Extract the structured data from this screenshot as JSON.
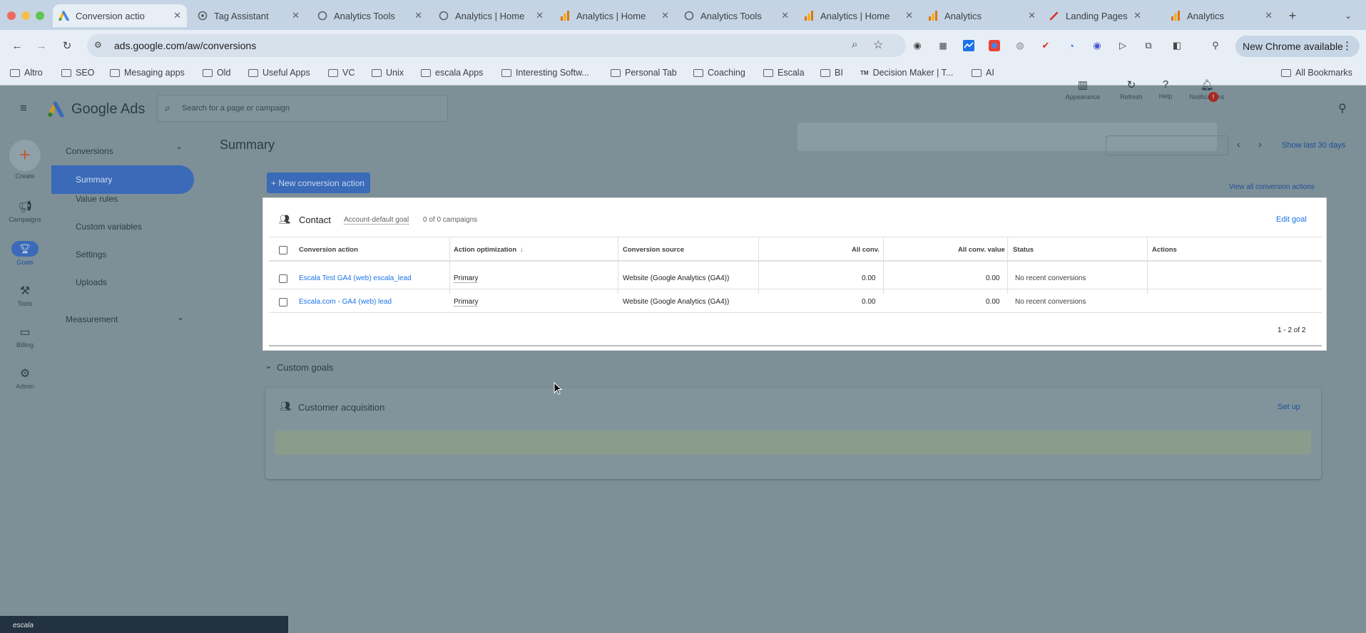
{
  "browser": {
    "tabs": [
      {
        "title": "Conversion actio",
        "icon": "google-ads-icon",
        "active": true
      },
      {
        "title": "Tag Assistant",
        "icon": "tag-assistant-icon",
        "active": false
      },
      {
        "title": "Analytics Tools",
        "icon": "google-icon",
        "active": false
      },
      {
        "title": "Analytics | Home",
        "icon": "google-icon",
        "active": false
      },
      {
        "title": "Analytics | Home",
        "icon": "analytics-icon",
        "active": false
      },
      {
        "title": "Analytics Tools",
        "icon": "google-icon",
        "active": false
      },
      {
        "title": "Analytics | Home",
        "icon": "analytics-icon",
        "active": false
      },
      {
        "title": "Analytics",
        "icon": "analytics-icon",
        "active": false
      },
      {
        "title": "Landing Pages",
        "icon": "pen-icon",
        "active": false
      },
      {
        "title": "Analytics",
        "icon": "analytics-icon",
        "active": false
      }
    ],
    "url": "ads.google.com/aw/conversions",
    "new_chrome_label": "New Chrome available",
    "bookmarks": [
      "Altro",
      "SEO",
      "Mesaging apps",
      "Old",
      "Useful Apps",
      "VC",
      "Unix",
      "escala Apps",
      "Interesting Softw...",
      "Personal Tab",
      "Coaching",
      "Escala",
      "BI",
      "Decision Maker | T...",
      "AI"
    ],
    "bookmarks_tm": "TM",
    "all_bookmarks_label": "All Bookmarks"
  },
  "app": {
    "name": "Google Ads",
    "search_placeholder": "Search for a page or campaign",
    "header_actions": [
      {
        "label": "Appearance",
        "icon": "appearance-icon"
      },
      {
        "label": "Refresh",
        "icon": "refresh-icon"
      },
      {
        "label": "Help",
        "icon": "help-icon"
      },
      {
        "label": "Notifications",
        "icon": "bell-icon"
      }
    ],
    "notification_badge": "!",
    "rail": [
      {
        "label": "Create",
        "icon": "plus-icon"
      },
      {
        "label": "Campaigns",
        "icon": "megaphone-icon"
      },
      {
        "label": "Goals",
        "icon": "trophy-icon"
      },
      {
        "label": "Tools",
        "icon": "tools-icon"
      },
      {
        "label": "Billing",
        "icon": "card-icon"
      },
      {
        "label": "Admin",
        "icon": "gear-icon"
      }
    ],
    "sidenav": {
      "section": "Conversions",
      "items": [
        "Summary",
        "Value rules",
        "Custom variables",
        "Settings",
        "Uploads"
      ],
      "section2": "Measurement"
    }
  },
  "main": {
    "title": "Summary",
    "date_label": "Show last 30 days",
    "new_action_label": "+ New conversion action",
    "view_all_label": "View all conversion actions",
    "contact_card": {
      "title": "Contact",
      "goal_label": "Account-default goal",
      "campaigns_label": "0 of 0 campaigns",
      "edit_label": "Edit goal",
      "columns": [
        "Conversion action",
        "Action optimization",
        "Conversion source",
        "All conv.",
        "All conv. value",
        "Status",
        "Actions"
      ],
      "rows": [
        {
          "action": "Escala Test GA4 (web) escala_lead",
          "optimization": "Primary",
          "source": "Website (Google Analytics (GA4))",
          "all_conv": "0.00",
          "all_conv_value": "0.00",
          "status": "No recent conversions"
        },
        {
          "action": "Escala.com - GA4 (web) lead",
          "optimization": "Primary",
          "source": "Website (Google Analytics (GA4))",
          "all_conv": "0.00",
          "all_conv_value": "0.00",
          "status": "No recent conversions"
        }
      ],
      "pagination": "1 - 2 of 2"
    },
    "custom_goals_label": "Custom goals",
    "acquisition_card": {
      "title": "Customer acquisition",
      "setup_label": "Set up"
    },
    "footer_thumb_text": "escala"
  },
  "colors": {
    "overlay": "#7d8f97",
    "link": "#1a73e8",
    "button": "#1a73e8"
  }
}
